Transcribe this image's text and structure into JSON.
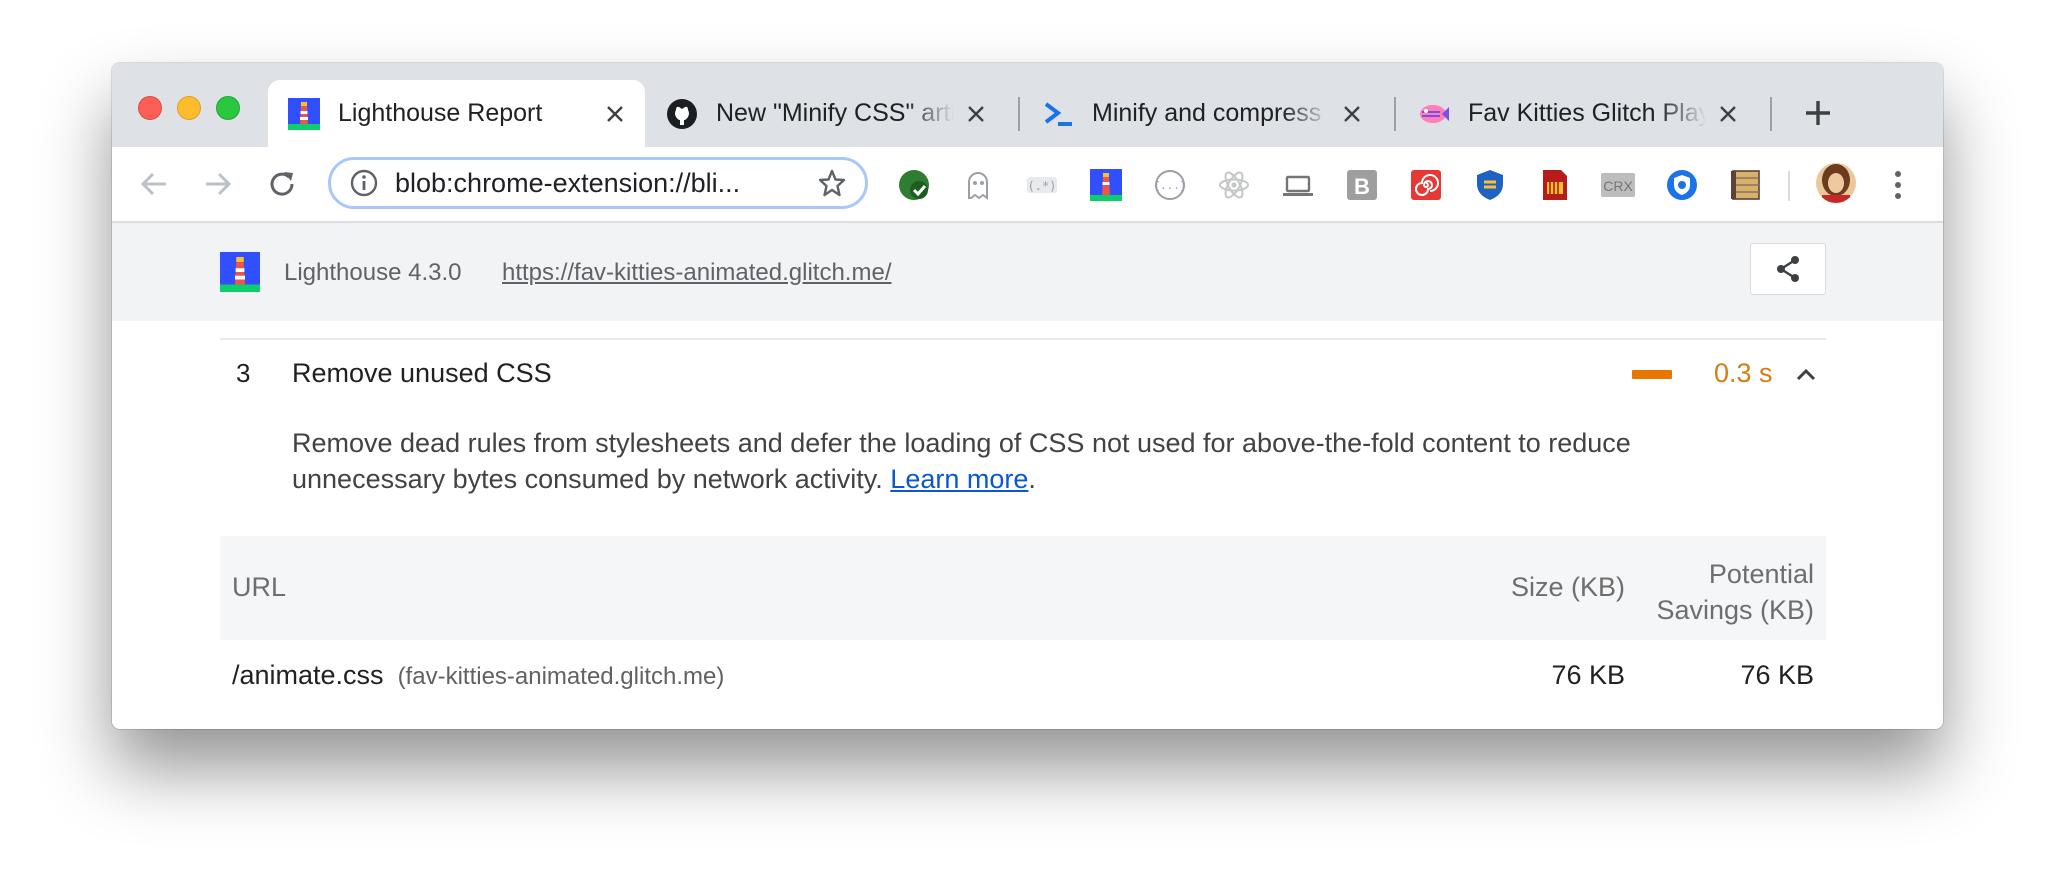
{
  "browser": {
    "tabs": [
      {
        "title": "Lighthouse Report",
        "icon": "lighthouse-icon",
        "active": true
      },
      {
        "title": "New \"Minify CSS\" article",
        "icon": "github-icon",
        "active": false
      },
      {
        "title": "Minify and compress network payloads",
        "icon": "prompt-icon",
        "active": false
      },
      {
        "title": "Fav Kitties Glitch Playground",
        "icon": "glitch-fish-icon",
        "active": false
      }
    ],
    "address": "blob:chrome-extension://bli...",
    "extensions": [
      "checkmark-extension-icon",
      "ghost-extension-icon",
      "regex-extension-icon",
      "lighthouse-extension-icon",
      "json-extension-icon",
      "react-extension-icon",
      "laptop-extension-icon",
      "b-extension-icon",
      "spiral-extension-icon",
      "shield-extension-icon",
      "sd-card-extension-icon",
      "crx-extension-icon",
      "privacy-extension-icon",
      "notebook-extension-icon"
    ],
    "crx_label": "CRX",
    "b_label": "B",
    "colors": {
      "tabstrip": "#dee1e6",
      "accent": "#1a73e8"
    }
  },
  "report": {
    "version": "Lighthouse 4.3.0",
    "url": "https://fav-kitties-animated.glitch.me/",
    "audit": {
      "number": "3",
      "title": "Remove unused CSS",
      "value": "0.3 s",
      "value_color": "#e67700",
      "description": "Remove dead rules from stylesheets and defer the loading of CSS not used for above-the-fold content to reduce unnecessary bytes consumed by network activity.",
      "learn_more": "Learn more",
      "period": "."
    },
    "table": {
      "headers": {
        "url": "URL",
        "size": "Size (KB)",
        "savings_line1": "Potential",
        "savings_line2": "Savings (KB)"
      },
      "rows": [
        {
          "url": "/animate.css",
          "host": "(fav-kitties-animated.glitch.me)",
          "size": "76 KB",
          "savings": "76 KB"
        }
      ]
    }
  }
}
